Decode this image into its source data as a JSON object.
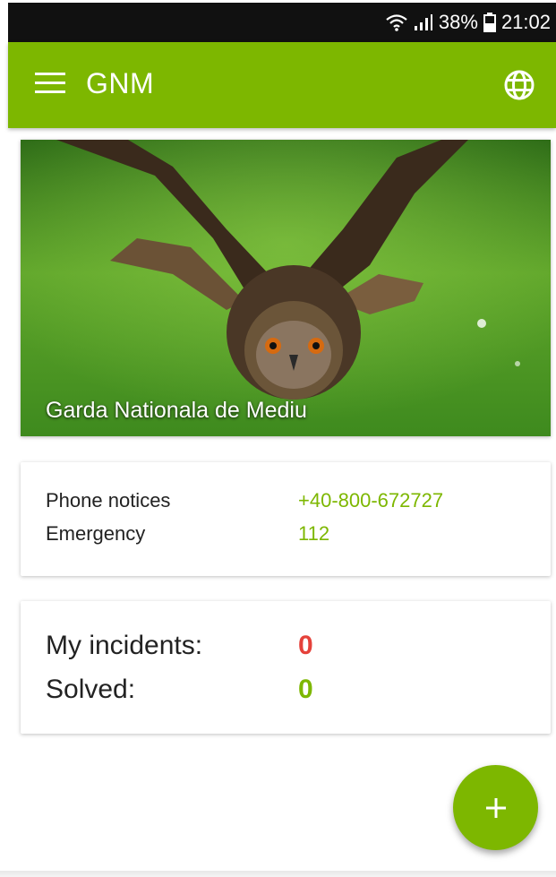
{
  "status_bar": {
    "battery_percent": "38%",
    "time": "21:02",
    "icons": [
      "wifi-icon",
      "signal-icon",
      "battery-icon"
    ]
  },
  "app_bar": {
    "title": "GNM",
    "icons": [
      "menu-icon",
      "globe-icon"
    ]
  },
  "hero": {
    "caption": "Garda Nationala de Mediu"
  },
  "contacts": [
    {
      "label": "Phone notices",
      "value": "+40-800-672727"
    },
    {
      "label": "Emergency",
      "value": "112"
    }
  ],
  "stats": [
    {
      "label": "My incidents:",
      "value": "0"
    },
    {
      "label": "Solved:",
      "value": "0"
    }
  ],
  "fab": {
    "label": "+"
  },
  "colors": {
    "primary": "#7db700",
    "danger": "#e5423b",
    "status_bar": "#111111"
  }
}
